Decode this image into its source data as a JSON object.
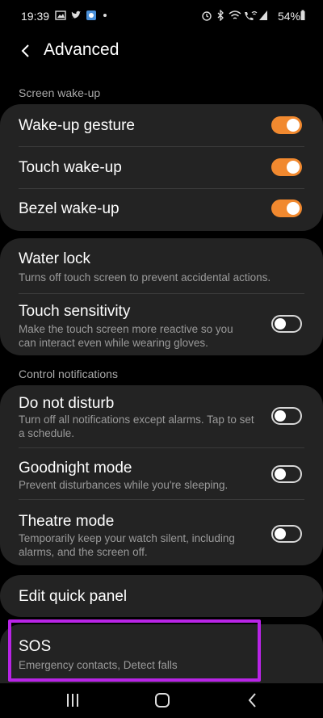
{
  "status": {
    "time": "19:39",
    "battery": "54%"
  },
  "header": {
    "title": "Advanced"
  },
  "sections": {
    "screen_wakeup": "Screen wake-up",
    "control_notifications": "Control notifications"
  },
  "wake": [
    {
      "title": "Wake-up gesture",
      "on": true
    },
    {
      "title": "Touch wake-up",
      "on": true
    },
    {
      "title": "Bezel wake-up",
      "on": true
    }
  ],
  "lock": {
    "water": {
      "title": "Water lock",
      "sub": "Turns off touch screen to prevent accidental actions."
    },
    "touch": {
      "title": "Touch sensitivity",
      "sub": "Make the touch screen more reactive so you can interact even while wearing gloves.",
      "on": false
    }
  },
  "notif": [
    {
      "title": "Do not disturb",
      "sub": "Turn off all notifications except alarms. Tap to set a schedule.",
      "on": false
    },
    {
      "title": "Goodnight mode",
      "sub": "Prevent disturbances while you're sleeping.",
      "on": false
    },
    {
      "title": "Theatre mode",
      "sub": "Temporarily keep your watch silent, including alarms, and the screen off.",
      "on": false
    }
  ],
  "quick": {
    "title": "Edit quick panel"
  },
  "sos": {
    "title": "SOS",
    "sub": "Emergency contacts, Detect falls"
  },
  "colors": {
    "accent": "#f1892f",
    "highlight": "#b824e6",
    "card": "#232323"
  }
}
